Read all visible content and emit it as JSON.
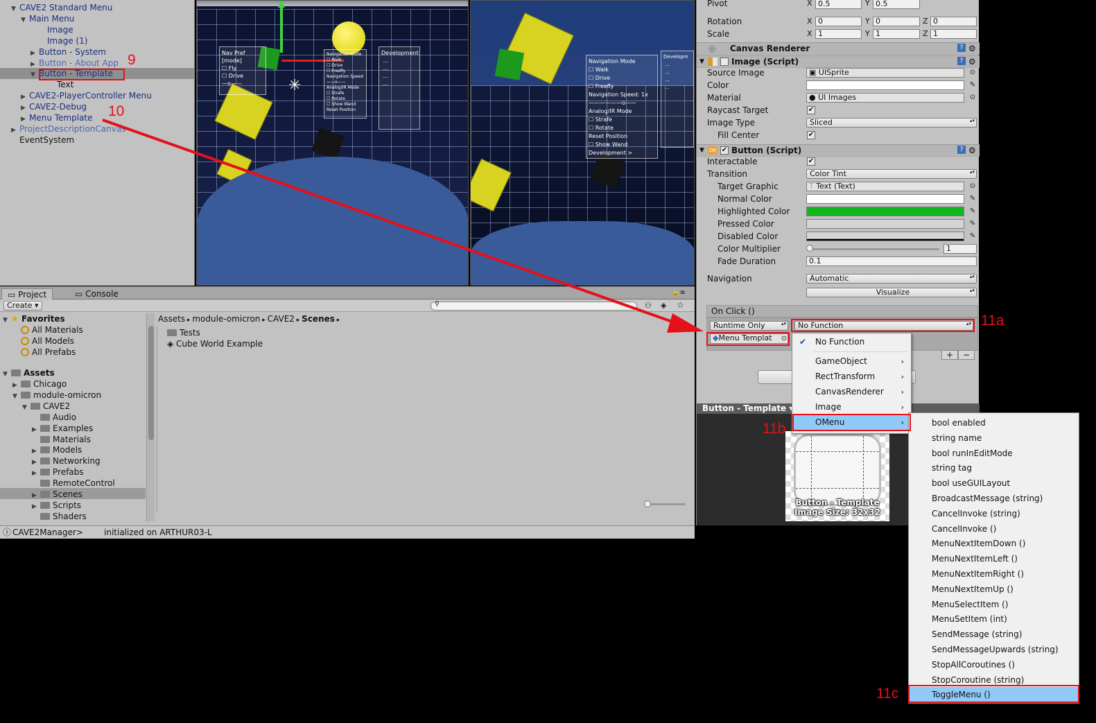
{
  "hierarchy": {
    "items": [
      {
        "label": "CAVE2 Standard Menu",
        "indent": 30,
        "tri": "▼",
        "color": "blue"
      },
      {
        "label": "Main Menu",
        "indent": 44,
        "tri": "▼",
        "color": "blue"
      },
      {
        "label": "Image",
        "indent": 70,
        "tri": "",
        "color": "blue"
      },
      {
        "label": "Image (1)",
        "indent": 70,
        "tri": "",
        "color": "blue"
      },
      {
        "label": "Button - System",
        "indent": 58,
        "tri": "▶",
        "color": "blue"
      },
      {
        "label": "Button - About App",
        "indent": 58,
        "tri": "▶",
        "color": "lightblue"
      },
      {
        "label": "Button - Template",
        "indent": 58,
        "tri": "▼",
        "color": "blue"
      },
      {
        "label": "Text",
        "indent": 84,
        "tri": "",
        "color": "black"
      },
      {
        "label": "CAVE2-PlayerController Menu",
        "indent": 44,
        "tri": "▶",
        "color": "blue"
      },
      {
        "label": "CAVE2-Debug",
        "indent": 44,
        "tri": "▶",
        "color": "blue"
      },
      {
        "label": "Menu Template",
        "indent": 44,
        "tri": "▶",
        "color": "blue"
      },
      {
        "label": "ProjectDescriptionCanvas",
        "indent": 30,
        "tri": "▶",
        "color": "lightblue"
      },
      {
        "label": "EventSystem",
        "indent": 30,
        "tri": "",
        "color": "black"
      }
    ]
  },
  "scene": {
    "panel_left": "Nav Pref\n[mode]\n☐ Fly\n☐ Drive\n—o——",
    "panel_mid": "Navigation Mode\n☐ Walk\n☐ Drive\n☐ Freefly\nNavigation Speed\n——o——\nAnalog/IR Mode\n☐ Strafe\n☐ Rotate\n☐ Show Wand\nReset Position",
    "panel_right": "Development\n ...\n ...\n ...\n ..."
  },
  "game": {
    "panel_mid": "Navigation Mode\n☐ Walk\n☐ Drive\n☐ Freefly\nNavigation Speed: 1x\n——————o——\nAnalog/IR Mode\n☐ Strafe\n☐ Rotate\nReset Position\n☐ Show Wand\nDevelopment >",
    "panel_right": "Developm\n ...\n ...\n ...\n ..."
  },
  "project": {
    "tabs": {
      "project": "Project",
      "console": "Console"
    },
    "create_label": "Create",
    "favorites_label": "Favorites",
    "favorites": [
      "All Materials",
      "All Models",
      "All Prefabs"
    ],
    "assets_label": "Assets",
    "tree": [
      {
        "label": "Chicago",
        "indent": 18,
        "tri": "▶"
      },
      {
        "label": "module-omicron",
        "indent": 18,
        "tri": "▼"
      },
      {
        "label": "CAVE2",
        "indent": 32,
        "tri": "▼"
      },
      {
        "label": "Audio",
        "indent": 46,
        "tri": ""
      },
      {
        "label": "Examples",
        "indent": 46,
        "tri": "▶"
      },
      {
        "label": "Materials",
        "indent": 46,
        "tri": ""
      },
      {
        "label": "Models",
        "indent": 46,
        "tri": "▶"
      },
      {
        "label": "Networking",
        "indent": 46,
        "tri": "▶"
      },
      {
        "label": "Prefabs",
        "indent": 46,
        "tri": "▶"
      },
      {
        "label": "RemoteControl",
        "indent": 46,
        "tri": ""
      },
      {
        "label": "Scenes",
        "indent": 46,
        "tri": "▶"
      },
      {
        "label": "Scripts",
        "indent": 46,
        "tri": "▶"
      },
      {
        "label": "Shaders",
        "indent": 46,
        "tri": ""
      }
    ],
    "breadcrumb": [
      "Assets",
      "module-omicron",
      "CAVE2",
      "Scenes"
    ],
    "files": [
      "Tests",
      "Cube World Example"
    ]
  },
  "status": {
    "left": "CAVE2Manager>",
    "right": "initialized on ARTHUR03-L"
  },
  "inspector": {
    "pivot_label": "Pivot",
    "pivot_x": "0.5",
    "pivot_y": "0.5",
    "rotation_label": "Rotation",
    "rot_x": "0",
    "rot_y": "0",
    "rot_z": "0",
    "scale_label": "Scale",
    "scale_x": "1",
    "scale_y": "1",
    "scale_z": "1",
    "canvas_renderer": "Canvas Renderer",
    "image_script": "Image (Script)",
    "source_image_label": "Source Image",
    "source_image": "UISprite",
    "color_label": "Color",
    "material_label": "Material",
    "material": "UI Images",
    "raycast_label": "Raycast Target",
    "image_type_label": "Image Type",
    "image_type": "Sliced",
    "fill_center_label": "Fill Center",
    "button_script": "Button (Script)",
    "interactable_label": "Interactable",
    "transition_label": "Transition",
    "transition": "Color Tint",
    "target_graphic_label": "Target Graphic",
    "target_graphic": "Text (Text)",
    "normal_color_label": "Normal Color",
    "highlighted_color_label": "Highlighted Color",
    "pressed_color_label": "Pressed Color",
    "disabled_color_label": "Disabled Color",
    "color_multiplier_label": "Color Multiplier",
    "color_multiplier": "1",
    "fade_duration_label": "Fade Duration",
    "fade_duration": "0.1",
    "navigation_label": "Navigation",
    "navigation": "Automatic",
    "visualize_label": "Visualize",
    "onclick_label": "On Click ()",
    "runtime": "Runtime Only",
    "function": "No Function",
    "object_field": "Menu Templat",
    "plus": "+",
    "minus": "−",
    "highlight_color": "#11b81c"
  },
  "preview": {
    "title": "Button - Template",
    "caption1": "Button - Template",
    "caption2": "Image Size: 32x32"
  },
  "menu1": {
    "items": [
      {
        "label": "No Function",
        "checked": true,
        "arrow": false
      },
      {
        "label": "GameObject",
        "arrow": true
      },
      {
        "label": "RectTransform",
        "arrow": true
      },
      {
        "label": "CanvasRenderer",
        "arrow": true
      },
      {
        "label": "Image",
        "arrow": true
      },
      {
        "label": "OMenu",
        "arrow": true,
        "highlighted": true
      }
    ]
  },
  "menu2": {
    "items": [
      "bool enabled",
      "string name",
      "bool runInEditMode",
      "string tag",
      "bool useGUILayout",
      "BroadcastMessage (string)",
      "CancelInvoke (string)",
      "CancelInvoke ()",
      "MenuNextItemDown ()",
      "MenuNextItemLeft ()",
      "MenuNextItemRight ()",
      "MenuNextItemUp ()",
      "MenuSelectItem ()",
      "MenuSetItem (int)",
      "SendMessage (string)",
      "SendMessageUpwards (string)",
      "StopAllCoroutines ()",
      "StopCoroutine (string)",
      "ToggleMenu ()"
    ]
  },
  "annotations": {
    "n9": "9",
    "n10": "10",
    "n11a": "11a",
    "n11b": "11b",
    "n11c": "11c",
    "color": "#e4101a"
  }
}
